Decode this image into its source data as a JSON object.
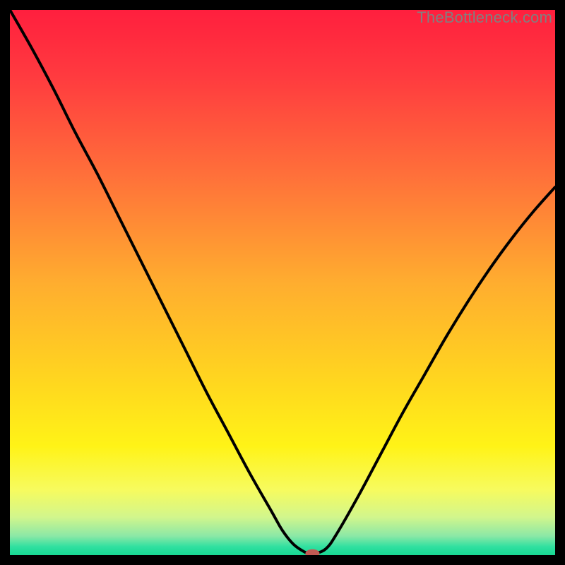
{
  "watermark": "TheBottleneck.com",
  "chart_data": {
    "type": "line",
    "title": "",
    "xlabel": "",
    "ylabel": "",
    "xlim": [
      0,
      100
    ],
    "ylim": [
      0,
      100
    ],
    "grid": false,
    "legend": false,
    "gradient_stops": [
      {
        "offset": 0.0,
        "color": "#ff1f3e"
      },
      {
        "offset": 0.12,
        "color": "#ff3a3f"
      },
      {
        "offset": 0.3,
        "color": "#ff6f3a"
      },
      {
        "offset": 0.5,
        "color": "#ffad2f"
      },
      {
        "offset": 0.68,
        "color": "#ffd61f"
      },
      {
        "offset": 0.8,
        "color": "#fff317"
      },
      {
        "offset": 0.88,
        "color": "#f7fb5e"
      },
      {
        "offset": 0.93,
        "color": "#d2f68c"
      },
      {
        "offset": 0.965,
        "color": "#8be8a6"
      },
      {
        "offset": 0.985,
        "color": "#2fe0a0"
      },
      {
        "offset": 1.0,
        "color": "#17d893"
      }
    ],
    "series": [
      {
        "name": "bottleneck-curve",
        "x": [
          0.0,
          4.0,
          8.0,
          12.0,
          16.0,
          20.0,
          24.0,
          28.0,
          32.0,
          36.0,
          40.0,
          44.0,
          48.0,
          50.0,
          52.0,
          54.0,
          55.0,
          56.0,
          58.0,
          60.0,
          64.0,
          68.0,
          72.0,
          76.0,
          80.0,
          84.0,
          88.0,
          92.0,
          96.0,
          100.0
        ],
        "y": [
          100.0,
          93.0,
          85.5,
          77.5,
          70.0,
          62.0,
          54.0,
          46.0,
          38.0,
          30.0,
          22.5,
          15.0,
          8.0,
          4.5,
          2.0,
          0.6,
          0.3,
          0.3,
          1.2,
          4.0,
          11.0,
          18.5,
          26.0,
          33.0,
          40.0,
          46.5,
          52.5,
          58.0,
          63.0,
          67.5
        ]
      }
    ],
    "marker": {
      "x": 55.5,
      "y": 0.3,
      "color": "#c15b54",
      "rx": 10,
      "ry": 6
    }
  }
}
